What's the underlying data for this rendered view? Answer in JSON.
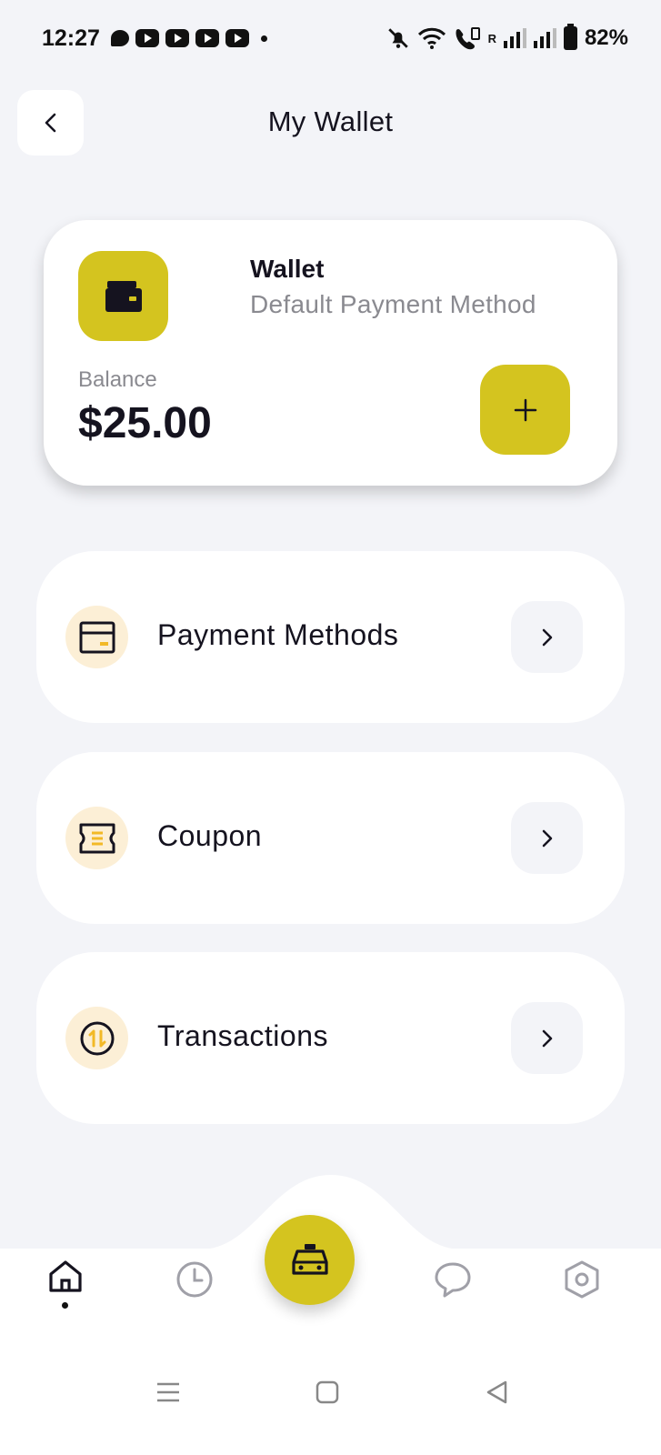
{
  "status_bar": {
    "time": "12:27",
    "battery": "82%",
    "roaming_indicator": "R",
    "icons": [
      "message-bubble-icon",
      "youtube-icon",
      "youtube-icon",
      "youtube-icon",
      "youtube-icon",
      "notification-dot-icon",
      "bell-off-icon",
      "wifi-icon",
      "volte-call-icon",
      "signal-icon",
      "signal-icon",
      "battery-icon"
    ]
  },
  "header": {
    "title": "My Wallet",
    "back_icon": "chevron-left-icon"
  },
  "wallet_card": {
    "icon": "wallet-icon",
    "name": "Wallet",
    "subtitle": "Default Payment Method",
    "balance_label": "Balance",
    "balance_value": "$25.00",
    "add_icon": "plus-icon"
  },
  "menu": [
    {
      "label": "Payment Methods",
      "icon": "credit-card-icon",
      "chevron": "chevron-right-icon"
    },
    {
      "label": "Coupon",
      "icon": "ticket-icon",
      "chevron": "chevron-right-icon"
    },
    {
      "label": "Transactions",
      "icon": "transfer-icon",
      "chevron": "chevron-right-icon"
    }
  ],
  "bottom_nav": {
    "items": [
      {
        "icon": "home-icon",
        "active": true
      },
      {
        "icon": "clock-icon",
        "active": false
      },
      {
        "icon": "taxi-icon",
        "active": false,
        "primary": true
      },
      {
        "icon": "chat-icon",
        "active": false
      },
      {
        "icon": "settings-icon",
        "active": false
      }
    ]
  },
  "colors": {
    "accent": "#d4c41f",
    "background": "#f3f4f8",
    "card": "#ffffff",
    "icon_bg": "#fcefd6",
    "text_primary": "#15131f",
    "text_secondary": "#8a8a90"
  }
}
